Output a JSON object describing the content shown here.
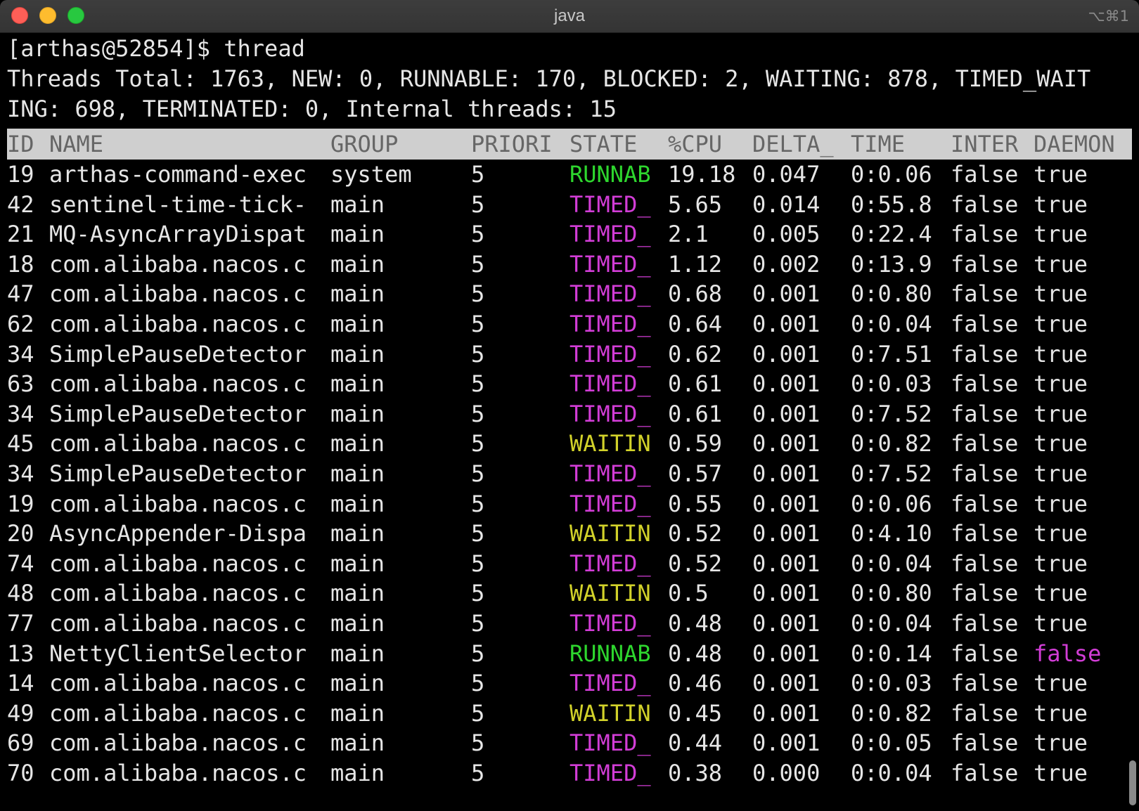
{
  "window": {
    "title": "java",
    "shortcut": "⌥⌘1"
  },
  "colors": {
    "runnable": "#2ed62e",
    "timed": "#d23dd6",
    "waiting": "#d2d22a",
    "normal": "#e6e6e6",
    "false_daemon": "#d23dd6"
  },
  "terminal": {
    "prompt_line": "[arthas@52854]$ thread",
    "summary_line1": "Threads Total: 1763, NEW: 0, RUNNABLE: 170, BLOCKED: 2, WAITING: 878, TIMED_WAIT",
    "summary_line2": "ING: 698, TERMINATED: 0, Internal threads: 15"
  },
  "table": {
    "headers": {
      "id": "ID",
      "name": "NAME",
      "group": "GROUP",
      "priority": "PRIORI",
      "state": "STATE",
      "cpu": "%CPU",
      "delta": "DELTA_",
      "time": "TIME",
      "interrupted": "INTER",
      "daemon": "DAEMON"
    },
    "rows": [
      {
        "id": "19",
        "name": "arthas-command-exec",
        "group": "system",
        "priority": "5",
        "state": "RUNNAB",
        "state_kind": "runnable",
        "cpu": "19.18",
        "delta": "0.047",
        "time": "0:0.06",
        "interrupted": "false",
        "daemon": "true"
      },
      {
        "id": "42",
        "name": "sentinel-time-tick-",
        "group": "main",
        "priority": "5",
        "state": "TIMED_",
        "state_kind": "timed",
        "cpu": "5.65",
        "delta": "0.014",
        "time": "0:55.8",
        "interrupted": "false",
        "daemon": "true"
      },
      {
        "id": "21",
        "name": "MQ-AsyncArrayDispat",
        "group": "main",
        "priority": "5",
        "state": "TIMED_",
        "state_kind": "timed",
        "cpu": "2.1",
        "delta": "0.005",
        "time": "0:22.4",
        "interrupted": "false",
        "daemon": "true"
      },
      {
        "id": "18",
        "name": "com.alibaba.nacos.c",
        "group": "main",
        "priority": "5",
        "state": "TIMED_",
        "state_kind": "timed",
        "cpu": "1.12",
        "delta": "0.002",
        "time": "0:13.9",
        "interrupted": "false",
        "daemon": "true"
      },
      {
        "id": "47",
        "name": "com.alibaba.nacos.c",
        "group": "main",
        "priority": "5",
        "state": "TIMED_",
        "state_kind": "timed",
        "cpu": "0.68",
        "delta": "0.001",
        "time": "0:0.80",
        "interrupted": "false",
        "daemon": "true"
      },
      {
        "id": "62",
        "name": "com.alibaba.nacos.c",
        "group": "main",
        "priority": "5",
        "state": "TIMED_",
        "state_kind": "timed",
        "cpu": "0.64",
        "delta": "0.001",
        "time": "0:0.04",
        "interrupted": "false",
        "daemon": "true"
      },
      {
        "id": "34",
        "name": "SimplePauseDetector",
        "group": "main",
        "priority": "5",
        "state": "TIMED_",
        "state_kind": "timed",
        "cpu": "0.62",
        "delta": "0.001",
        "time": "0:7.51",
        "interrupted": "false",
        "daemon": "true"
      },
      {
        "id": "63",
        "name": "com.alibaba.nacos.c",
        "group": "main",
        "priority": "5",
        "state": "TIMED_",
        "state_kind": "timed",
        "cpu": "0.61",
        "delta": "0.001",
        "time": "0:0.03",
        "interrupted": "false",
        "daemon": "true"
      },
      {
        "id": "34",
        "name": "SimplePauseDetector",
        "group": "main",
        "priority": "5",
        "state": "TIMED_",
        "state_kind": "timed",
        "cpu": "0.61",
        "delta": "0.001",
        "time": "0:7.52",
        "interrupted": "false",
        "daemon": "true"
      },
      {
        "id": "45",
        "name": "com.alibaba.nacos.c",
        "group": "main",
        "priority": "5",
        "state": "WAITIN",
        "state_kind": "waiting",
        "cpu": "0.59",
        "delta": "0.001",
        "time": "0:0.82",
        "interrupted": "false",
        "daemon": "true"
      },
      {
        "id": "34",
        "name": "SimplePauseDetector",
        "group": "main",
        "priority": "5",
        "state": "TIMED_",
        "state_kind": "timed",
        "cpu": "0.57",
        "delta": "0.001",
        "time": "0:7.52",
        "interrupted": "false",
        "daemon": "true"
      },
      {
        "id": "19",
        "name": "com.alibaba.nacos.c",
        "group": "main",
        "priority": "5",
        "state": "TIMED_",
        "state_kind": "timed",
        "cpu": "0.55",
        "delta": "0.001",
        "time": "0:0.06",
        "interrupted": "false",
        "daemon": "true"
      },
      {
        "id": "20",
        "name": "AsyncAppender-Dispa",
        "group": "main",
        "priority": "5",
        "state": "WAITIN",
        "state_kind": "waiting",
        "cpu": "0.52",
        "delta": "0.001",
        "time": "0:4.10",
        "interrupted": "false",
        "daemon": "true"
      },
      {
        "id": "74",
        "name": "com.alibaba.nacos.c",
        "group": "main",
        "priority": "5",
        "state": "TIMED_",
        "state_kind": "timed",
        "cpu": "0.52",
        "delta": "0.001",
        "time": "0:0.04",
        "interrupted": "false",
        "daemon": "true"
      },
      {
        "id": "48",
        "name": "com.alibaba.nacos.c",
        "group": "main",
        "priority": "5",
        "state": "WAITIN",
        "state_kind": "waiting",
        "cpu": "0.5",
        "delta": "0.001",
        "time": "0:0.80",
        "interrupted": "false",
        "daemon": "true"
      },
      {
        "id": "77",
        "name": "com.alibaba.nacos.c",
        "group": "main",
        "priority": "5",
        "state": "TIMED_",
        "state_kind": "timed",
        "cpu": "0.48",
        "delta": "0.001",
        "time": "0:0.04",
        "interrupted": "false",
        "daemon": "true"
      },
      {
        "id": "13",
        "name": "NettyClientSelector",
        "group": "main",
        "priority": "5",
        "state": "RUNNAB",
        "state_kind": "runnable",
        "cpu": "0.48",
        "delta": "0.001",
        "time": "0:0.14",
        "interrupted": "false",
        "daemon": "false"
      },
      {
        "id": "14",
        "name": "com.alibaba.nacos.c",
        "group": "main",
        "priority": "5",
        "state": "TIMED_",
        "state_kind": "timed",
        "cpu": "0.46",
        "delta": "0.001",
        "time": "0:0.03",
        "interrupted": "false",
        "daemon": "true"
      },
      {
        "id": "49",
        "name": "com.alibaba.nacos.c",
        "group": "main",
        "priority": "5",
        "state": "WAITIN",
        "state_kind": "waiting",
        "cpu": "0.45",
        "delta": "0.001",
        "time": "0:0.82",
        "interrupted": "false",
        "daemon": "true"
      },
      {
        "id": "69",
        "name": "com.alibaba.nacos.c",
        "group": "main",
        "priority": "5",
        "state": "TIMED_",
        "state_kind": "timed",
        "cpu": "0.44",
        "delta": "0.001",
        "time": "0:0.05",
        "interrupted": "false",
        "daemon": "true"
      },
      {
        "id": "70",
        "name": "com.alibaba.nacos.c",
        "group": "main",
        "priority": "5",
        "state": "TIMED_",
        "state_kind": "timed",
        "cpu": "0.38",
        "delta": "0.000",
        "time": "0:0.04",
        "interrupted": "false",
        "daemon": "true"
      }
    ]
  }
}
